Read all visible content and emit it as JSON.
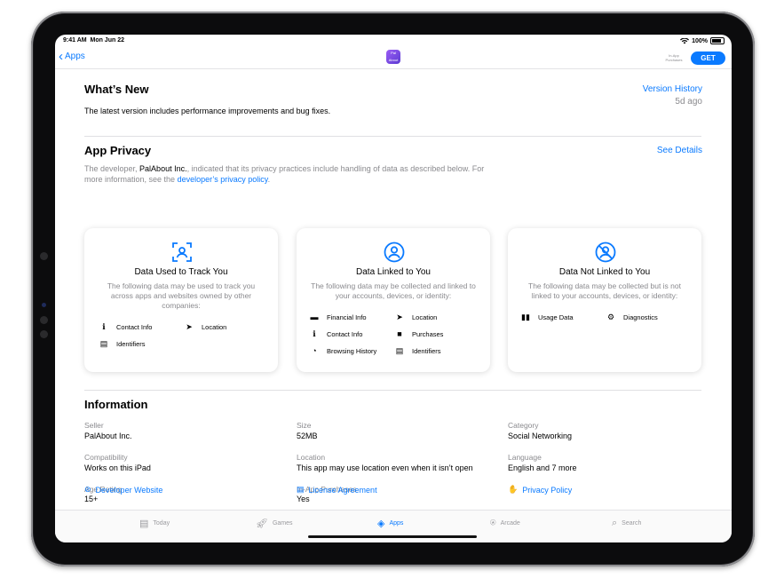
{
  "status_bar": {
    "time": "9:41 AM",
    "date": "Mon Jun 22",
    "battery": "100%"
  },
  "nav": {
    "back_label": "Apps",
    "app_icon_text": "Pal About",
    "iap_label": "In-App Purchases",
    "get_label": "GET"
  },
  "whats_new": {
    "title": "What’s New",
    "version_history": "Version History",
    "ago": "5d ago",
    "text": "The latest version includes performance improvements and bug fixes."
  },
  "privacy": {
    "title": "App Privacy",
    "see_details": "See Details",
    "desc_prefix": "The developer, ",
    "developer": "PalAbout Inc.",
    "desc_middle": ", indicated that its privacy practices include handling of data as described below. For more information, see the ",
    "policy_link": "developer’s privacy policy",
    "desc_end": ".",
    "cards": [
      {
        "title": "Data Used to Track You",
        "desc": "The following data may be used to track you across apps and websites owned by other companies:",
        "items": [
          "Contact Info",
          "Location",
          "Identifiers"
        ]
      },
      {
        "title": "Data Linked to You",
        "desc": "The following data may be collected and linked to your accounts, devices, or identity:",
        "items": [
          "Financial Info",
          "Location",
          "Contact Info",
          "Purchases",
          "Browsing History",
          "Identifiers"
        ]
      },
      {
        "title": "Data Not Linked to You",
        "desc": "The following data may be collected but is not linked to your accounts, devices, or identity:",
        "items": [
          "Usage Data",
          "Diagnostics"
        ]
      }
    ]
  },
  "information": {
    "title": "Information",
    "fields": [
      {
        "label": "Seller",
        "value": "PalAbout Inc."
      },
      {
        "label": "Size",
        "value": "52MB"
      },
      {
        "label": "Category",
        "value": "Social Networking"
      },
      {
        "label": "Compatibility",
        "value": "Works on this iPad"
      },
      {
        "label": "Location",
        "value": "This app may use location even when it isn’t open"
      },
      {
        "label": "Language",
        "value": "English and 7 more"
      },
      {
        "label": "Age Rating",
        "value": "15+"
      },
      {
        "label": "In-App Purchases",
        "value": "Yes"
      }
    ],
    "links": [
      "Developer Website",
      "License Agreement",
      "Privacy Policy"
    ]
  },
  "tabs": [
    {
      "label": "Today",
      "icon": "today-icon"
    },
    {
      "label": "Games",
      "icon": "rocket-icon"
    },
    {
      "label": "Apps",
      "icon": "apps-stack-icon",
      "active": true
    },
    {
      "label": "Arcade",
      "icon": "joystick-icon"
    },
    {
      "label": "Search",
      "icon": "search-icon"
    }
  ],
  "colors": {
    "accent": "#0a7aff",
    "secondary_text": "#8a8a8e"
  }
}
